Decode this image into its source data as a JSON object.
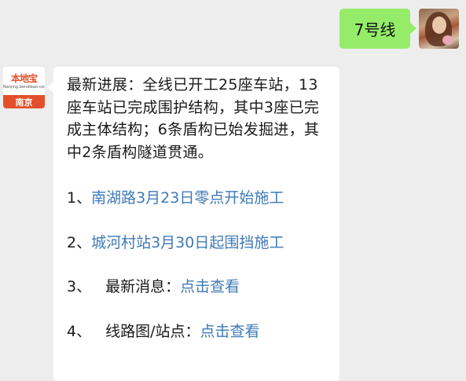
{
  "user_message": {
    "text": "7号线"
  },
  "bot": {
    "avatar": {
      "brand": "本地宝",
      "url_text": "Nanjing.bendibao.com",
      "city": "南京"
    },
    "intro_text": "最新进展：全线已开工25座车站，13座车站已完成围护结构，其中3座已完成主体结构；6条盾构已始发掘进，其中2条盾构隧道贯通。",
    "items": [
      {
        "number": "1、",
        "label": "",
        "link": "南湖路3月23日零点开始施工"
      },
      {
        "number": "2、",
        "label": "",
        "link": "城河村站3月30日起围挡施工"
      },
      {
        "number": "3、",
        "label": "最新消息：",
        "link": "点击查看"
      },
      {
        "number": "4、",
        "label": "线路图/站点：",
        "link": "点击查看"
      }
    ]
  },
  "colors": {
    "background": "#ededed",
    "user_bubble": "#95ec69",
    "bot_bubble": "#ffffff",
    "link": "#3f7ab8",
    "brand": "#e2502b"
  }
}
